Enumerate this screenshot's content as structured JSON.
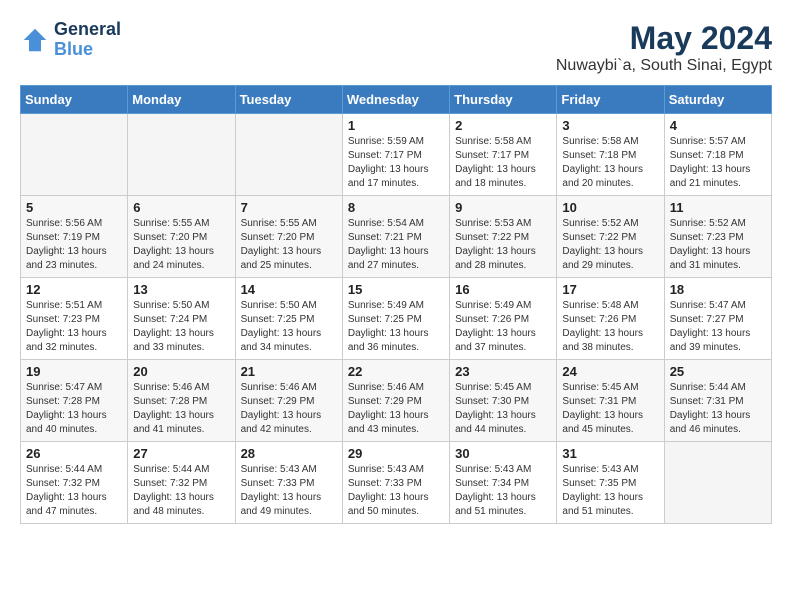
{
  "header": {
    "logo_line1": "General",
    "logo_line2": "Blue",
    "month": "May 2024",
    "location": "Nuwaybi`a, South Sinai, Egypt"
  },
  "weekdays": [
    "Sunday",
    "Monday",
    "Tuesday",
    "Wednesday",
    "Thursday",
    "Friday",
    "Saturday"
  ],
  "weeks": [
    [
      {
        "day": "",
        "empty": true
      },
      {
        "day": "",
        "empty": true
      },
      {
        "day": "",
        "empty": true
      },
      {
        "day": "1",
        "sunrise": "5:59 AM",
        "sunset": "7:17 PM",
        "daylight": "13 hours and 17 minutes."
      },
      {
        "day": "2",
        "sunrise": "5:58 AM",
        "sunset": "7:17 PM",
        "daylight": "13 hours and 18 minutes."
      },
      {
        "day": "3",
        "sunrise": "5:58 AM",
        "sunset": "7:18 PM",
        "daylight": "13 hours and 20 minutes."
      },
      {
        "day": "4",
        "sunrise": "5:57 AM",
        "sunset": "7:18 PM",
        "daylight": "13 hours and 21 minutes."
      }
    ],
    [
      {
        "day": "5",
        "sunrise": "5:56 AM",
        "sunset": "7:19 PM",
        "daylight": "13 hours and 23 minutes."
      },
      {
        "day": "6",
        "sunrise": "5:55 AM",
        "sunset": "7:20 PM",
        "daylight": "13 hours and 24 minutes."
      },
      {
        "day": "7",
        "sunrise": "5:55 AM",
        "sunset": "7:20 PM",
        "daylight": "13 hours and 25 minutes."
      },
      {
        "day": "8",
        "sunrise": "5:54 AM",
        "sunset": "7:21 PM",
        "daylight": "13 hours and 27 minutes."
      },
      {
        "day": "9",
        "sunrise": "5:53 AM",
        "sunset": "7:22 PM",
        "daylight": "13 hours and 28 minutes."
      },
      {
        "day": "10",
        "sunrise": "5:52 AM",
        "sunset": "7:22 PM",
        "daylight": "13 hours and 29 minutes."
      },
      {
        "day": "11",
        "sunrise": "5:52 AM",
        "sunset": "7:23 PM",
        "daylight": "13 hours and 31 minutes."
      }
    ],
    [
      {
        "day": "12",
        "sunrise": "5:51 AM",
        "sunset": "7:23 PM",
        "daylight": "13 hours and 32 minutes."
      },
      {
        "day": "13",
        "sunrise": "5:50 AM",
        "sunset": "7:24 PM",
        "daylight": "13 hours and 33 minutes."
      },
      {
        "day": "14",
        "sunrise": "5:50 AM",
        "sunset": "7:25 PM",
        "daylight": "13 hours and 34 minutes."
      },
      {
        "day": "15",
        "sunrise": "5:49 AM",
        "sunset": "7:25 PM",
        "daylight": "13 hours and 36 minutes."
      },
      {
        "day": "16",
        "sunrise": "5:49 AM",
        "sunset": "7:26 PM",
        "daylight": "13 hours and 37 minutes."
      },
      {
        "day": "17",
        "sunrise": "5:48 AM",
        "sunset": "7:26 PM",
        "daylight": "13 hours and 38 minutes."
      },
      {
        "day": "18",
        "sunrise": "5:47 AM",
        "sunset": "7:27 PM",
        "daylight": "13 hours and 39 minutes."
      }
    ],
    [
      {
        "day": "19",
        "sunrise": "5:47 AM",
        "sunset": "7:28 PM",
        "daylight": "13 hours and 40 minutes."
      },
      {
        "day": "20",
        "sunrise": "5:46 AM",
        "sunset": "7:28 PM",
        "daylight": "13 hours and 41 minutes."
      },
      {
        "day": "21",
        "sunrise": "5:46 AM",
        "sunset": "7:29 PM",
        "daylight": "13 hours and 42 minutes."
      },
      {
        "day": "22",
        "sunrise": "5:46 AM",
        "sunset": "7:29 PM",
        "daylight": "13 hours and 43 minutes."
      },
      {
        "day": "23",
        "sunrise": "5:45 AM",
        "sunset": "7:30 PM",
        "daylight": "13 hours and 44 minutes."
      },
      {
        "day": "24",
        "sunrise": "5:45 AM",
        "sunset": "7:31 PM",
        "daylight": "13 hours and 45 minutes."
      },
      {
        "day": "25",
        "sunrise": "5:44 AM",
        "sunset": "7:31 PM",
        "daylight": "13 hours and 46 minutes."
      }
    ],
    [
      {
        "day": "26",
        "sunrise": "5:44 AM",
        "sunset": "7:32 PM",
        "daylight": "13 hours and 47 minutes."
      },
      {
        "day": "27",
        "sunrise": "5:44 AM",
        "sunset": "7:32 PM",
        "daylight": "13 hours and 48 minutes."
      },
      {
        "day": "28",
        "sunrise": "5:43 AM",
        "sunset": "7:33 PM",
        "daylight": "13 hours and 49 minutes."
      },
      {
        "day": "29",
        "sunrise": "5:43 AM",
        "sunset": "7:33 PM",
        "daylight": "13 hours and 50 minutes."
      },
      {
        "day": "30",
        "sunrise": "5:43 AM",
        "sunset": "7:34 PM",
        "daylight": "13 hours and 51 minutes."
      },
      {
        "day": "31",
        "sunrise": "5:43 AM",
        "sunset": "7:35 PM",
        "daylight": "13 hours and 51 minutes."
      },
      {
        "day": "",
        "empty": true
      }
    ]
  ]
}
